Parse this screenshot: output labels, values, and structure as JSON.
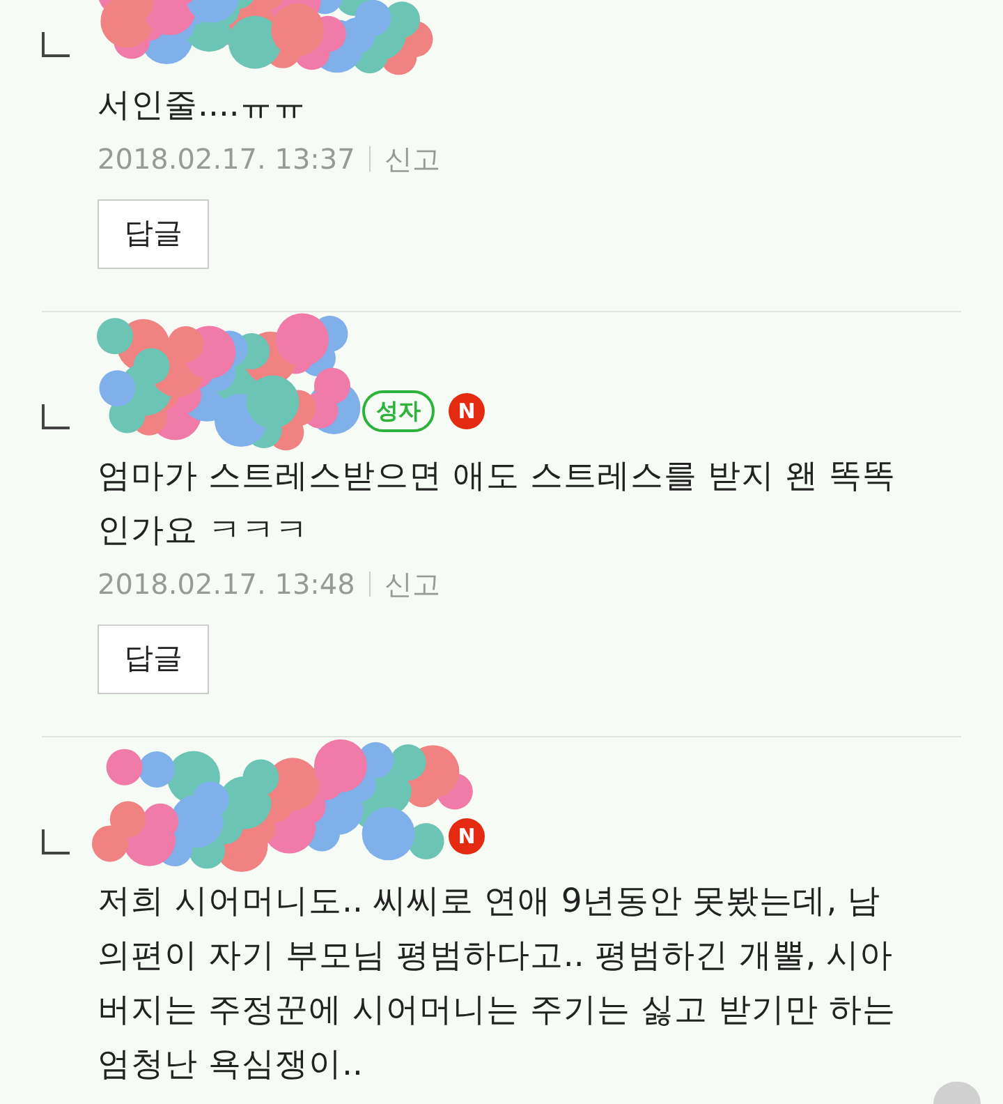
{
  "comments": [
    {
      "text": "서인줄....ㅠㅠ",
      "date": "2018.02.17. 13:37",
      "report": "신고",
      "reply_button": "답글"
    },
    {
      "badge": "성자",
      "new_mark": "N",
      "text": "엄마가 스트레스받으면 애도 스트레스를 받지 왠 똑똑인가요 ㅋㅋㅋ",
      "date": "2018.02.17. 13:48",
      "report": "신고",
      "reply_button": "답글"
    },
    {
      "new_mark": "N",
      "text": "저희 시어머니도.. 씨씨로 연애 9년동안 못봤는데, 남의편이 자기 부모님 평범하다고.. 평범하긴 개뿔, 시아버지는 주정꾼에 시어머니는 주기는 싫고 받기만 하는 엄청난 욕심쟁이.."
    }
  ]
}
